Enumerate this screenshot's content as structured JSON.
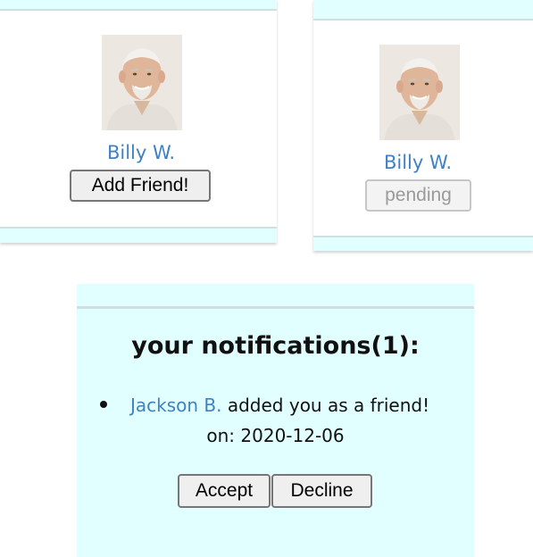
{
  "friend_cards": [
    {
      "name": "Billy W.",
      "action_label": "Add Friend!"
    },
    {
      "name": "Billy W.",
      "action_label": "pending"
    }
  ],
  "notifications": {
    "title": "your notifications(1):",
    "items": [
      {
        "user": "Jackson B.",
        "message": " added you as a friend!",
        "date_prefix": "on: ",
        "date": "2020-12-06"
      }
    ],
    "accept_label": "Accept",
    "decline_label": "Decline"
  },
  "colors": {
    "link": "#3e82c4",
    "panel_bg": "#e2ffff"
  }
}
